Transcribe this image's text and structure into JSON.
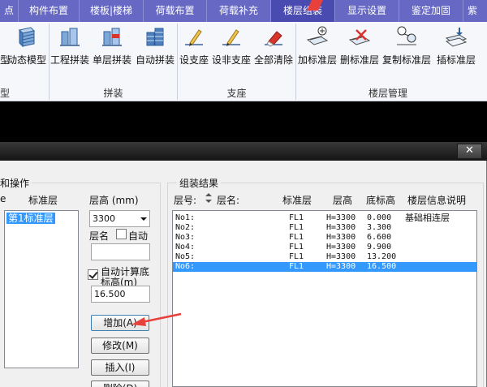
{
  "tabs": [
    {
      "label": "点",
      "active": false
    },
    {
      "label": "构件布置",
      "active": false
    },
    {
      "label": "楼板|楼梯",
      "active": false
    },
    {
      "label": "荷载布置",
      "active": false
    },
    {
      "label": "荷载补充",
      "active": false
    },
    {
      "label": "楼层组装",
      "active": true
    },
    {
      "label": "显示设置",
      "active": false
    },
    {
      "label": "鉴定加固",
      "active": false
    },
    {
      "label": "紫",
      "active": false
    }
  ],
  "ribbon": {
    "buttons": [
      {
        "label": "型",
        "icon": "model-icon"
      },
      {
        "label": "动态模型",
        "icon": "dynamic-model-icon"
      },
      {
        "label": "工程拼装",
        "icon": "project-assembly-icon"
      },
      {
        "label": "单层拼装",
        "icon": "single-floor-assembly-icon"
      },
      {
        "label": "自动拼装",
        "icon": "auto-assembly-icon"
      },
      {
        "label": "设支座",
        "icon": "set-support-icon"
      },
      {
        "label": "设非支座",
        "icon": "set-non-support-icon"
      },
      {
        "label": "全部清除",
        "icon": "clear-all-icon"
      },
      {
        "label": "加标准层",
        "icon": "add-standard-floor-icon"
      },
      {
        "label": "删标准层",
        "icon": "delete-standard-floor-icon"
      },
      {
        "label": "复制标准层",
        "icon": "copy-standard-floor-icon"
      },
      {
        "label": "插标准层",
        "icon": "insert-standard-floor-icon"
      }
    ],
    "groups": {
      "first": "型",
      "assembly": "拼装",
      "support": "支座",
      "floor_mgmt": "楼层管理"
    }
  },
  "dialog": {
    "close_label": "✕",
    "left_group": {
      "title": "和操作",
      "std_floor_header": "标准层",
      "std_floor_items": [
        "第1标准层"
      ],
      "floor_height_label": "层高 (mm)",
      "floor_height_value": "3300",
      "floor_name_label": "层名",
      "auto_label": "自动",
      "auto_checked": false,
      "floor_name_value": "",
      "auto_calc_label_1": "自动计算底",
      "auto_calc_label_2": "标高(m)",
      "auto_calc_checked": true,
      "base_elev_value": "16.500",
      "buttons": {
        "add": "增加(A)",
        "modify": "修改(M)",
        "insert": "插入(I)",
        "delete": "删除(D)"
      }
    },
    "result_group": {
      "title": "组装结果",
      "headers": {
        "floor_no": "层号:",
        "floor_name": "层名:",
        "std_floor": "标准层",
        "height": "层高",
        "base_elev": "底标高",
        "desc": "楼层信息说明"
      },
      "rows": [
        {
          "no": "No1:",
          "std": "FL1",
          "height": "H=3300",
          "elev": "0.000",
          "desc": "基础相连层",
          "selected": false
        },
        {
          "no": "No2:",
          "std": "FL1",
          "height": "H=3300",
          "elev": "3.300",
          "desc": "",
          "selected": false
        },
        {
          "no": "No3:",
          "std": "FL1",
          "height": "H=3300",
          "elev": "6.600",
          "desc": "",
          "selected": false
        },
        {
          "no": "No4:",
          "std": "FL1",
          "height": "H=3300",
          "elev": "9.900",
          "desc": "",
          "selected": false
        },
        {
          "no": "No5:",
          "std": "FL1",
          "height": "H=3300",
          "elev": "13.200",
          "desc": "",
          "selected": false
        },
        {
          "no": "No6:",
          "std": "FL1",
          "height": "H=3300",
          "elev": "16.500",
          "desc": "",
          "selected": true
        }
      ]
    }
  },
  "colors": {
    "tab_bar": "#6668c4",
    "tab_active": "#4a4bb0",
    "selection": "#3399ff",
    "annotation_arrow": "#e8403a"
  }
}
